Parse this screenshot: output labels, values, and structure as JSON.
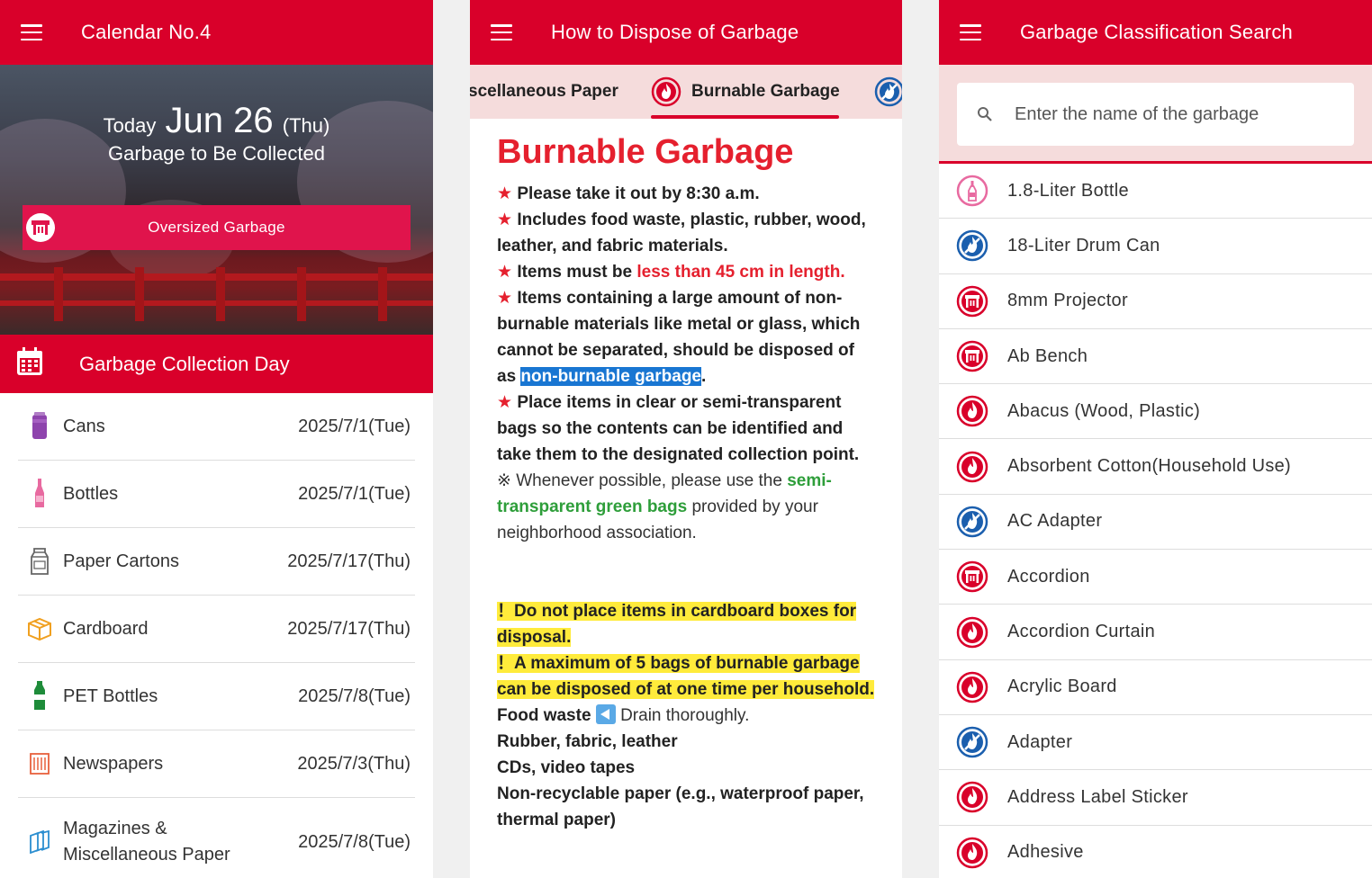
{
  "screen1": {
    "title": "Calendar No.4",
    "today_label": "Today",
    "today_date": "Jun 26",
    "today_dow": "(Thu)",
    "collect_label": "Garbage to Be Collected",
    "oversized_label": "Oversized Garbage",
    "section_title": "Garbage Collection Day",
    "rows": [
      {
        "name": "Cans",
        "date": "2025/7/1(Tue)",
        "icon": "can-icon"
      },
      {
        "name": "Bottles",
        "date": "2025/7/1(Tue)",
        "icon": "bottle-icon"
      },
      {
        "name": "Paper Cartons",
        "date": "2025/7/17(Thu)",
        "icon": "carton-icon"
      },
      {
        "name": "Cardboard",
        "date": "2025/7/17(Thu)",
        "icon": "cardboard-icon"
      },
      {
        "name": "PET Bottles",
        "date": "2025/7/8(Tue)",
        "icon": "pet-bottle-icon"
      },
      {
        "name": "Newspapers",
        "date": "2025/7/3(Thu)",
        "icon": "newspaper-icon"
      },
      {
        "name_line1": "Magazines &",
        "name_line2": "Miscellaneous Paper",
        "date": "2025/7/8(Tue)",
        "icon": "magazine-icon"
      }
    ]
  },
  "screen2": {
    "title": "How to Dispose of Garbage",
    "tab_prev": "scellaneous Paper",
    "tab_active": "Burnable Garbage",
    "heading": "Burnable Garbage",
    "star": "★",
    "p1": "Please take it out by 8:30 a.m.",
    "p2": "Includes food waste, plastic, rubber, wood, leather, and fabric materials.",
    "p3a": "Items must be ",
    "p3b": "less than 45 cm in length.",
    "p4a": "Items containing a large amount of non-burnable materials like metal or glass, which cannot be separated, should be disposed of as ",
    "p4b": "non-burnable garbage",
    "p4c": ".",
    "p5": "Place items in clear or semi-transparent bags so the contents can be identified and take them to the designated collection point.",
    "p6a": "※ Whenever possible, please use the ",
    "p6b": "semi-transparent green bags",
    "p6c": " provided by your neighborhood association.",
    "warn1": "！Do not place items in cardboard boxes for disposal.",
    "warn2": "！A maximum of 5 bags of burnable garbage can be disposed of at one time per household.",
    "food_a": "Food waste ",
    "food_b": " Drain thoroughly.",
    "l2": "Rubber, fabric, leather",
    "l3": "CDs, video tapes",
    "l4": "Non-recyclable paper (e.g., waterproof paper, thermal paper)"
  },
  "screen3": {
    "title": "Garbage Classification Search",
    "search_placeholder": "Enter the name of the garbage",
    "items": [
      {
        "name": "1.8-Liter Bottle",
        "type": "bottle"
      },
      {
        "name": "18-Liter Drum Can",
        "type": "nonburnable"
      },
      {
        "name": "8mm Projector",
        "type": "oversized"
      },
      {
        "name": "Ab Bench",
        "type": "oversized"
      },
      {
        "name": "Abacus (Wood, Plastic)",
        "type": "burnable"
      },
      {
        "name": "Absorbent Cotton(Household Use)",
        "type": "burnable"
      },
      {
        "name": "AC Adapter",
        "type": "nonburnable"
      },
      {
        "name": "Accordion",
        "type": "oversized"
      },
      {
        "name": "Accordion Curtain",
        "type": "burnable"
      },
      {
        "name": "Acrylic Board",
        "type": "burnable"
      },
      {
        "name": "Adapter",
        "type": "nonburnable"
      },
      {
        "name": "Address Label Sticker",
        "type": "burnable"
      },
      {
        "name": "Adhesive",
        "type": "burnable"
      }
    ]
  },
  "colors": {
    "brand_red": "#d9002a",
    "burnable": "#d9002a",
    "nonburnable": "#1b5fae",
    "bottle": "#e86aa0",
    "tab_bg": "#f5dcdc"
  }
}
